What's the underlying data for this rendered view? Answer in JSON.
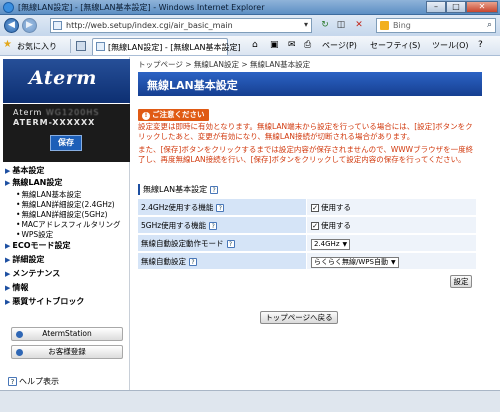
{
  "window": {
    "title": "[無線LAN設定] - [無線LAN基本設定] - Windows Internet Explorer",
    "address": "http://web.setup/index.cgi/air_basic_main",
    "search_placeholder": "Bing"
  },
  "favbar": {
    "favorites": "お気に入り",
    "tab": "[無線LAN設定] - [無線LAN基本設定]",
    "page_menu": "ページ(P)",
    "safety_menu": "セーフティ(S)",
    "tools_menu": "ツール(O)"
  },
  "sidebar": {
    "logo": "Aterm",
    "model_line1_prefix": "Aterm ",
    "model_line1_masked": "WG1200HS",
    "model_line2": "ATERM-XXXXXX",
    "save": "保存",
    "menu": [
      {
        "label": "基本設定"
      },
      {
        "label": "無線LAN設定",
        "sub": [
          "無線LAN基本設定",
          "無線LAN詳細設定(2.4GHz)",
          "無線LAN詳細設定(5GHz)",
          "MACアドレスフィルタリング",
          "WPS設定"
        ]
      },
      {
        "label": "ECOモード設定"
      },
      {
        "label": "詳細設定"
      },
      {
        "label": "メンテナンス"
      },
      {
        "label": "情報"
      },
      {
        "label": "悪質サイトブロック"
      }
    ],
    "aterm_station": "AtermStation",
    "register": "お客様登録",
    "help": "ヘルプ表示"
  },
  "main": {
    "breadcrumb": "トップページ > 無線LAN設定 > 無線LAN基本設定",
    "title": "無線LAN基本設定",
    "notice_badge": "ご注意ください",
    "notice_1": "設定変更は即時に有効となります。無線LAN端末から設定を行っている場合には、[設定]ボタンをクリックしたあと、変更が有効になり、無線LAN接続が切断される場合があります。",
    "notice_2": "また、[保存]ボタンをクリックするまでは設定内容が保存されませんので、WWWブラウザを一度終了し、再度無線LAN接続を行い、[保存]ボタンをクリックして設定内容の保存を行ってください。",
    "section_title": "無線LAN基本設定",
    "rows": [
      {
        "label": "2.4GHz使用する機能",
        "value": "使用する"
      },
      {
        "label": "5GHz使用する機能",
        "value": "使用する"
      },
      {
        "label": "無線自動設定動作モード",
        "value": "2.4GHz"
      },
      {
        "label": "無線自動設定",
        "value": "らくらく無線/WPS自動"
      }
    ],
    "set_button": "設定",
    "back_button": "トップページへ戻る"
  }
}
